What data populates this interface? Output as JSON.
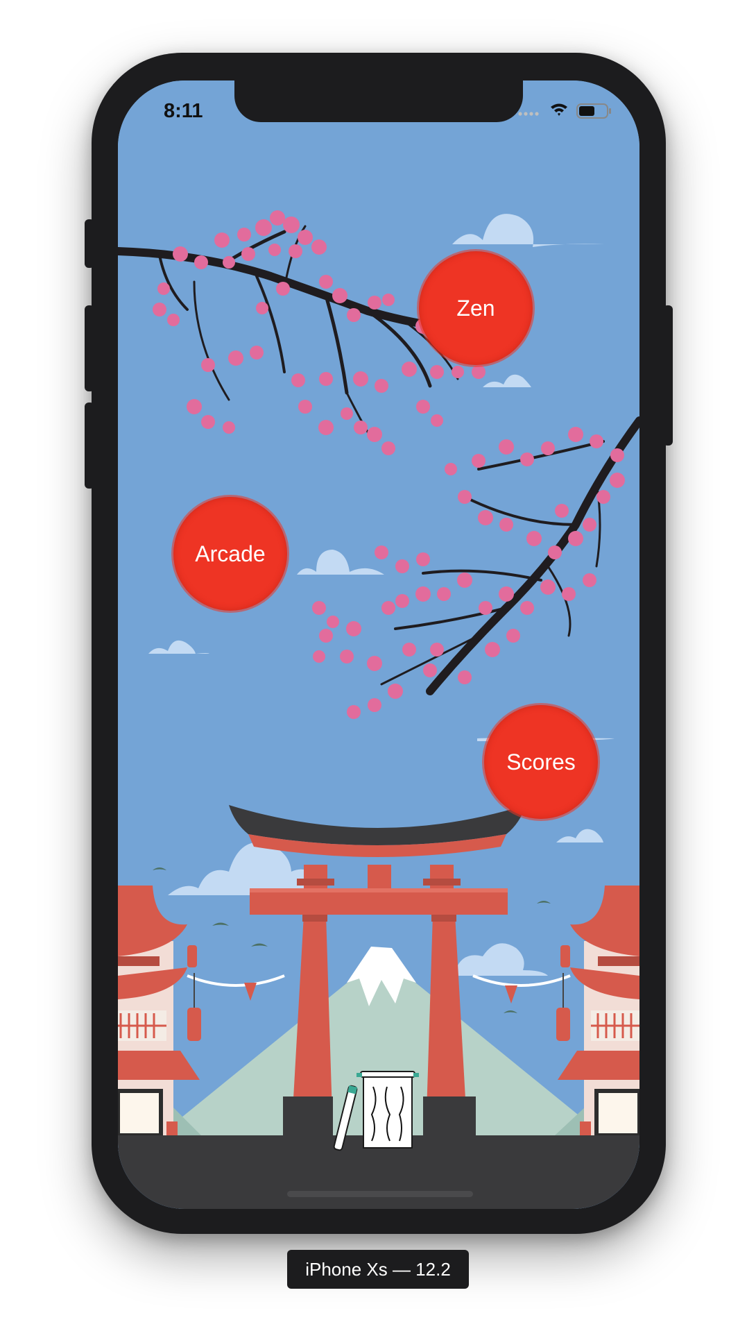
{
  "status_bar": {
    "time": "8:11"
  },
  "menu": {
    "zen_label": "Zen",
    "arcade_label": "Arcade",
    "scores_label": "Scores"
  },
  "device": {
    "label": "iPhone Xs — 12.2"
  },
  "icons": [
    "wifi-icon",
    "battery-icon",
    "signal-icon",
    "scroll-icon",
    "brush-icon"
  ],
  "colors": {
    "sky": "#74a4d6",
    "button_red": "#ee3424",
    "torii_red": "#d65a4c",
    "blossom_pink": "#e26c9c"
  }
}
